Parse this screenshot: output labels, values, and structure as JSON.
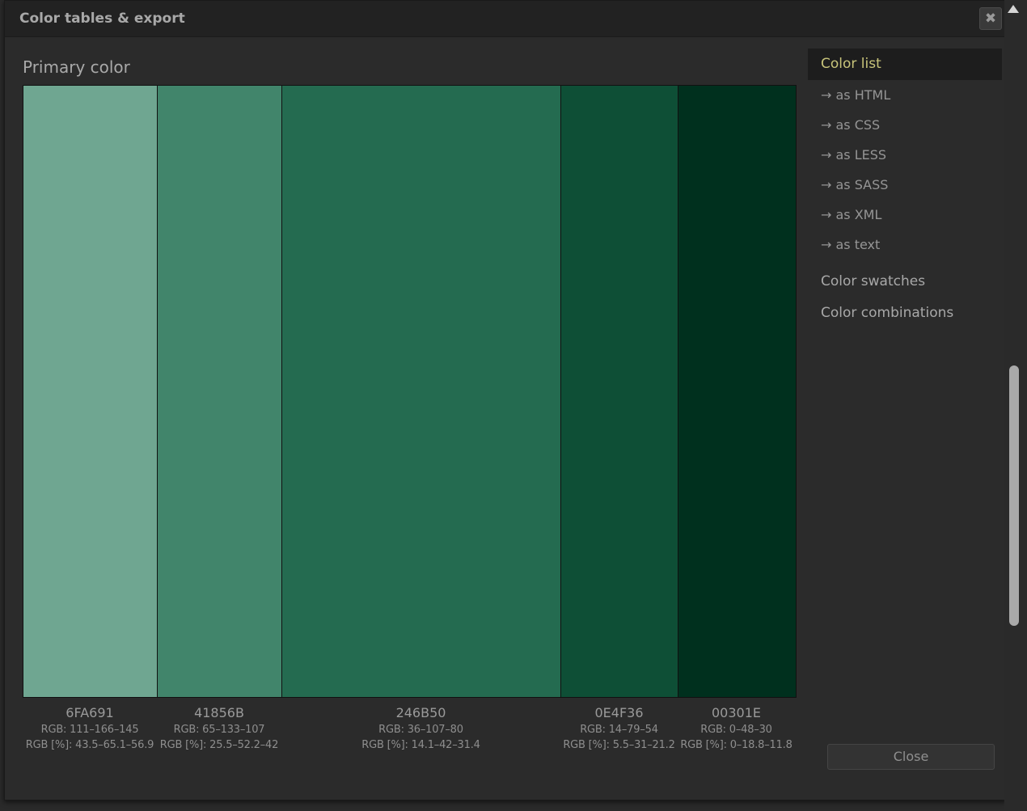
{
  "dialog": {
    "title": "Color tables & export",
    "close_icon": "close-icon"
  },
  "section": {
    "title": "Primary color"
  },
  "swatches": [
    {
      "hex": "6FA691",
      "color": "#6FA691",
      "rgb": "RGB: 111–166–145",
      "rgb_pct": "RGB [%]: 43.5–65.1–56.9"
    },
    {
      "hex": "41856B",
      "color": "#41856B",
      "rgb": "RGB: 65–133–107",
      "rgb_pct": "RGB [%]: 25.5–52.2–42"
    },
    {
      "hex": "246B50",
      "color": "#246B50",
      "rgb": "RGB: 36–107–80",
      "rgb_pct": "RGB [%]: 14.1–42–31.4"
    },
    {
      "hex": "0E4F36",
      "color": "#0E4F36",
      "rgb": "RGB: 14–79–54",
      "rgb_pct": "RGB [%]: 5.5–31–21.2"
    },
    {
      "hex": "00301E",
      "color": "#00301E",
      "rgb": "RGB: 0–48–30",
      "rgb_pct": "RGB [%]: 0–18.8–11.8"
    }
  ],
  "sidebar": {
    "active": "Color list",
    "exports": [
      "→ as HTML",
      "→ as CSS",
      "→ as LESS",
      "→ as SASS",
      "→ as XML",
      "→ as text"
    ],
    "swatches": "Color swatches",
    "combinations": "Color combinations"
  },
  "footer": {
    "close_label": "Close"
  },
  "colors": {
    "active_accent": "#c8c47a",
    "background": "#2b2b2b"
  }
}
